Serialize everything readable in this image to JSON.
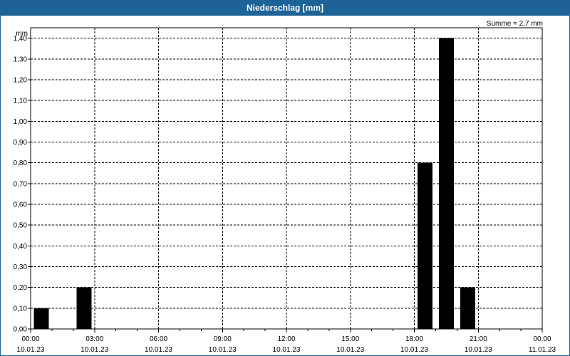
{
  "title": "Niederschlag [mm]",
  "chart_data": {
    "type": "bar",
    "unit_label": "mm",
    "sum_label": "Summe = 2,7 mm",
    "x_range_hours": [
      0,
      24
    ],
    "ylim": [
      0,
      1.45
    ],
    "y_ticks": [
      {
        "value": 0.0,
        "label": "0,00"
      },
      {
        "value": 0.1,
        "label": "0,10"
      },
      {
        "value": 0.2,
        "label": "0,20"
      },
      {
        "value": 0.3,
        "label": "0,30"
      },
      {
        "value": 0.4,
        "label": "0,40"
      },
      {
        "value": 0.5,
        "label": "0,50"
      },
      {
        "value": 0.6,
        "label": "0,60"
      },
      {
        "value": 0.7,
        "label": "0,70"
      },
      {
        "value": 0.8,
        "label": "0,80"
      },
      {
        "value": 0.9,
        "label": "0,90"
      },
      {
        "value": 1.0,
        "label": "1,00"
      },
      {
        "value": 1.1,
        "label": "1,10"
      },
      {
        "value": 1.2,
        "label": "1,20"
      },
      {
        "value": 1.3,
        "label": "1,30"
      },
      {
        "value": 1.4,
        "label": "1,40"
      }
    ],
    "x_ticks": [
      {
        "hour": 0,
        "time": "00:00",
        "date": "10.01.23"
      },
      {
        "hour": 3,
        "time": "03:00",
        "date": "10.01.23"
      },
      {
        "hour": 6,
        "time": "06:00",
        "date": "10.01.23"
      },
      {
        "hour": 9,
        "time": "09:00",
        "date": "10.01.23"
      },
      {
        "hour": 12,
        "time": "12:00",
        "date": "10.01.23"
      },
      {
        "hour": 15,
        "time": "15:00",
        "date": "10.01.23"
      },
      {
        "hour": 18,
        "time": "18:00",
        "date": "10.01.23"
      },
      {
        "hour": 21,
        "time": "21:00",
        "date": "10.01.23"
      },
      {
        "hour": 24,
        "time": "00:00",
        "date": "11.01.23"
      }
    ],
    "bars": [
      {
        "hour_start": 0,
        "hour_end": 1,
        "value": 0.1
      },
      {
        "hour_start": 2,
        "hour_end": 3,
        "value": 0.2
      },
      {
        "hour_start": 18,
        "hour_end": 19,
        "value": 0.8
      },
      {
        "hour_start": 19,
        "hour_end": 20,
        "value": 1.4
      },
      {
        "hour_start": 20,
        "hour_end": 21,
        "value": 0.2
      }
    ],
    "bar_color": "#000000",
    "grid": true,
    "grid_style": "dashed",
    "minor_x_ticks": "hourly"
  }
}
